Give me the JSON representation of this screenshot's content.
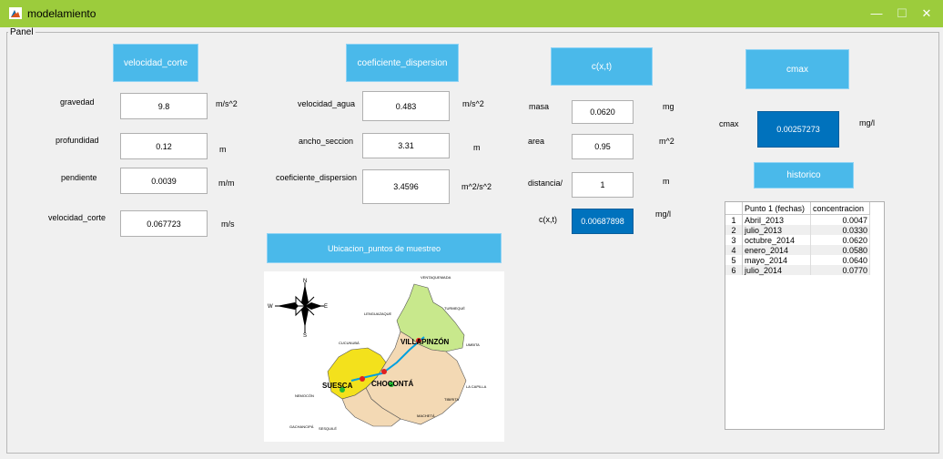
{
  "window": {
    "title": "modelamiento",
    "minimize": "—",
    "maximize": "☐",
    "close": "✕"
  },
  "panel": {
    "label": "Panel"
  },
  "buttons": {
    "velocidad_corte": "velocidad_corte",
    "coeficiente_dispersion": "coeficiente_dispersion",
    "cxt": "c(x,t)",
    "cmax": "cmax",
    "historico": "historico",
    "ubicacion": "Ubicacion_puntos de muestreo"
  },
  "col1": {
    "gravedad": {
      "label": "gravedad",
      "value": "9.8",
      "unit": "m/s^2"
    },
    "profundidad": {
      "label": "profundidad",
      "value": "0.12",
      "unit": "m"
    },
    "pendiente": {
      "label": "pendiente",
      "value": "0.0039",
      "unit": "m/m"
    },
    "velocidad_corte": {
      "label": "velocidad_corte",
      "value": "0.067723",
      "unit": "m/s"
    }
  },
  "col2": {
    "velocidad_agua": {
      "label": "velocidad_agua",
      "value": "0.483",
      "unit": "m/s^2"
    },
    "ancho_seccion": {
      "label": "ancho_seccion",
      "value": "3.31",
      "unit": "m"
    },
    "coeficiente_dispersion": {
      "label": "coeficiente_dispersion",
      "value": "3.4596",
      "unit": "m^2/s^2"
    }
  },
  "col3": {
    "masa": {
      "label": "masa",
      "value": "0.0620",
      "unit": "mg"
    },
    "area": {
      "label": "area",
      "value": "0.95",
      "unit": "m^2"
    },
    "distancia": {
      "label": "distancia/",
      "value": "1",
      "unit": "m"
    },
    "cxt": {
      "label": "c(x,t)",
      "value": "0.00687898",
      "unit": "mg/l"
    }
  },
  "col4": {
    "cmax": {
      "label": "cmax",
      "value": "0.00257273",
      "unit": "mg/l"
    }
  },
  "table": {
    "headers": [
      "Punto 1 (fechas)",
      "concentracion"
    ],
    "rows": [
      {
        "idx": "1",
        "fecha": "Abril_2013",
        "conc": "0.0047"
      },
      {
        "idx": "2",
        "fecha": "julio_2013",
        "conc": "0.0330"
      },
      {
        "idx": "3",
        "fecha": "octubre_2014",
        "conc": "0.0620"
      },
      {
        "idx": "4",
        "fecha": "enero_2014",
        "conc": "0.0580"
      },
      {
        "idx": "5",
        "fecha": "mayo_2014",
        "conc": "0.0640"
      },
      {
        "idx": "6",
        "fecha": "julio_2014",
        "conc": "0.0770"
      }
    ]
  },
  "map": {
    "compass": {
      "n": "N",
      "s": "S",
      "e": "E",
      "w": "W"
    },
    "labels": {
      "ventaquemada": "VENTAQUEMADA",
      "lenguazaque": "LENGUAZAQUE",
      "turmeque": "TURMEQUÉ",
      "cucunuba": "CUCUNUBÁ",
      "villapinzon": "VILLAPINZÓN",
      "umbita": "UMBITA",
      "suesca": "SUESCA",
      "chocontra": "CHOCONTÁ",
      "nemocon": "NEMOCÓN",
      "la_capilla": "LA CAPILLA",
      "tibirita": "TIBIRITA",
      "machetá": "MACHETÁ",
      "gachancipa": "GACHANCIPÁ",
      "sesquile": "SESQUILÉ"
    }
  }
}
